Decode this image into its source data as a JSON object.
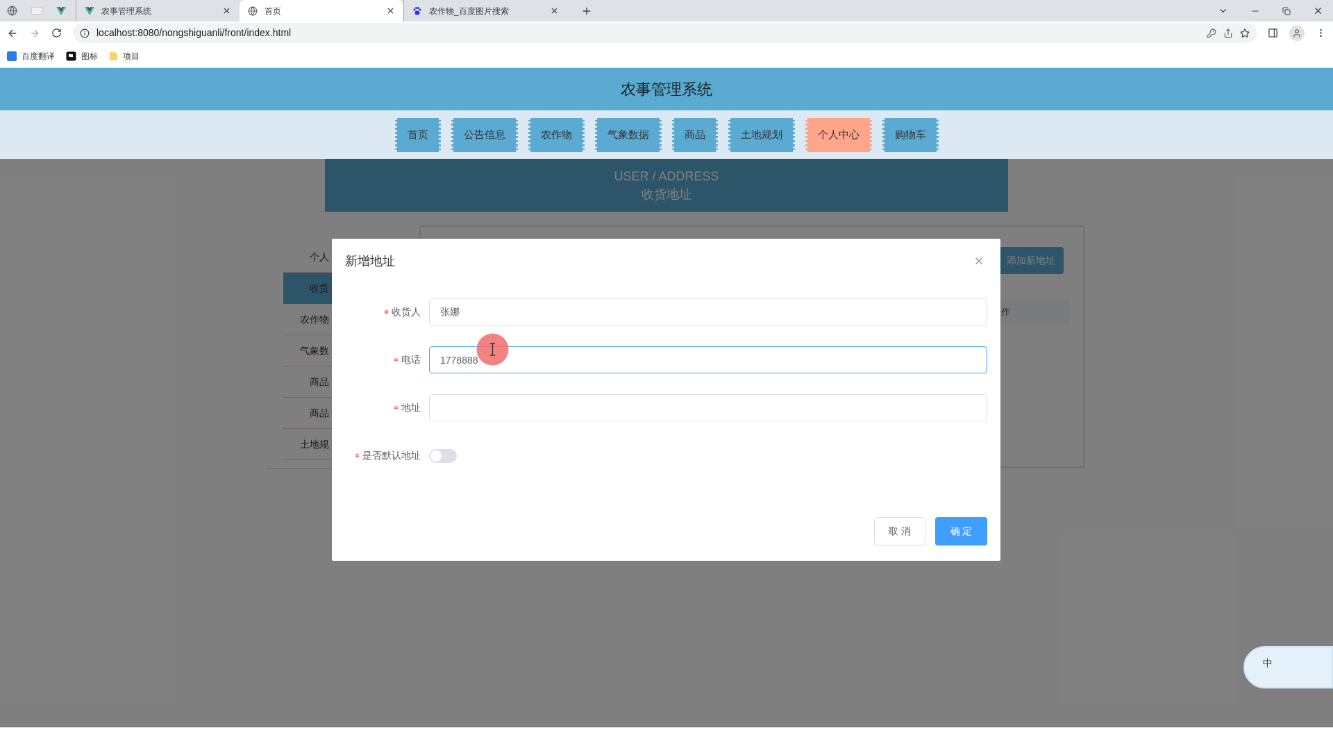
{
  "browser": {
    "tabs": [
      {
        "kind": "vue",
        "label": "农事管理系统",
        "selected": false
      },
      {
        "kind": "globe",
        "label": "首页",
        "selected": true
      },
      {
        "kind": "paw",
        "label": "农作物_百度图片搜索",
        "selected": false
      }
    ],
    "url": "localhost:8080/nongshiguanli/front/index.html",
    "bookmarks": [
      {
        "kind": "translate",
        "label": "百度翻译"
      },
      {
        "kind": "flag",
        "label": "图标"
      },
      {
        "kind": "folder",
        "label": "项目"
      }
    ]
  },
  "site": {
    "title": "农事管理系统",
    "nav": [
      {
        "label": "首页",
        "selected": false
      },
      {
        "label": "公告信息",
        "selected": false
      },
      {
        "label": "农作物",
        "selected": false
      },
      {
        "label": "气象数据",
        "selected": false
      },
      {
        "label": "商品",
        "selected": false
      },
      {
        "label": "土地规划",
        "selected": false
      },
      {
        "label": "个人中心",
        "selected": true
      },
      {
        "label": "购物车",
        "selected": false
      }
    ],
    "banner": {
      "subtitle": "USER / ADDRESS",
      "title": "收货地址"
    },
    "sidebar": [
      {
        "label": "个人",
        "selected": false
      },
      {
        "label": "收货",
        "selected": true
      },
      {
        "label": "农作物",
        "selected": false
      },
      {
        "label": "气象数",
        "selected": false
      },
      {
        "label": "商品",
        "selected": false
      },
      {
        "label": "商品",
        "selected": false
      },
      {
        "label": "土地规",
        "selected": false
      }
    ],
    "card": {
      "add_button": "添加新地址",
      "table_header": "作"
    }
  },
  "dialog": {
    "title": "新增地址",
    "fields": [
      {
        "label": "收货人",
        "required": true,
        "value": "张娜",
        "focused": false
      },
      {
        "label": "电话",
        "required": true,
        "value": "1778888",
        "focused": true
      },
      {
        "label": "地址",
        "required": true,
        "focused": false
      }
    ],
    "switch": {
      "label": "是否默认地址",
      "required": true,
      "on": false
    },
    "buttons": [
      {
        "kind": "cancel",
        "label": "取 消"
      },
      {
        "kind": "confirm",
        "label": "确 定"
      }
    ]
  },
  "ime": {
    "label": "中"
  }
}
